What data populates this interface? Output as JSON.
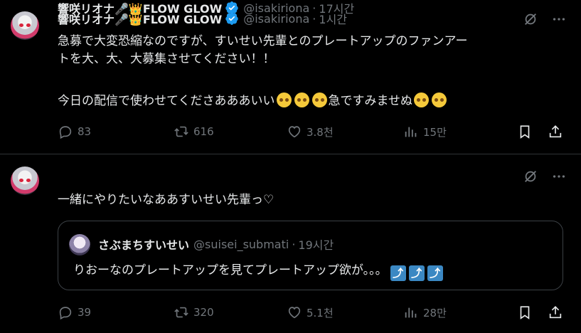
{
  "tweets": [
    {
      "author": "響咲リオナ🎤👑FLOW GLOW",
      "handle": "@isakiriona",
      "time": "1시간",
      "line1": "急募で大変恐縮なのですが、すいせい先輩とのプレートアップのファンアー",
      "line2": "トを大、大、大募集させてください！！",
      "line3_text": "今日の配信で使わせてくださあああいい",
      "line3_tail": "急ですみませぬ",
      "replies": "83",
      "reposts": "616",
      "likes": "3.8천",
      "views": "15만"
    },
    {
      "author": "響咲リオナ🎤👑FLOW GLOW",
      "handle": "@isakiriona",
      "time": "17시간",
      "line1": "一緒にやりたいなああすいせい先輩っ♡",
      "quote": {
        "author": "さぶまちすいせい",
        "handle": "@suisei_submati",
        "time": "19시간",
        "text": "りおーなのプレートアップを見てプレートアップ欲が。。。"
      },
      "replies": "39",
      "reposts": "320",
      "likes": "5.1천",
      "views": "28만"
    }
  ],
  "ui": {
    "dot": "·",
    "arrow_glyph": "⤴"
  },
  "icons": [
    "more-icon",
    "grok-icon",
    "reply-icon",
    "repost-icon",
    "like-icon",
    "views-icon",
    "bookmark-icon",
    "share-icon",
    "verified-icon"
  ],
  "colors": {
    "background": "#000000",
    "text": "#e7e9ea",
    "muted": "#71767b",
    "verified": "#1d9bf0",
    "border": "#2f3336"
  }
}
